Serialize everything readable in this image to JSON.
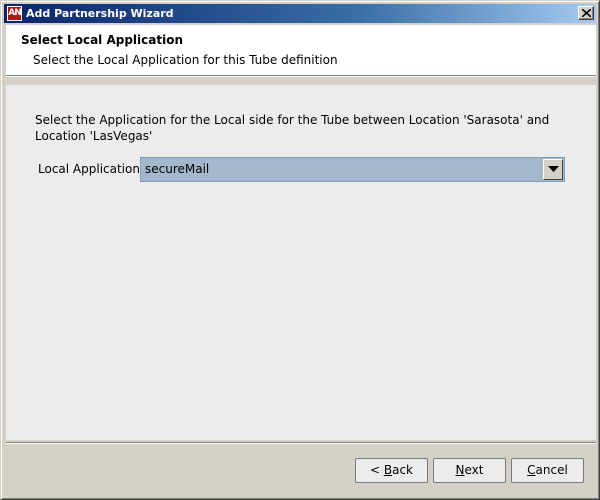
{
  "window": {
    "title": "Add Partnership Wizard",
    "app_icon_glyph": "AN",
    "accent_color": "#0a246a",
    "close_icon": "close-icon"
  },
  "header": {
    "title": "Select Local Application",
    "subtitle": "Select the Local Application for this Tube definition"
  },
  "main": {
    "instruction": "Select the Application for the Local side for the Tube between Location 'Sarasota' and Location 'LasVegas'",
    "local_application": {
      "label": "Local Application",
      "value": "secureMail",
      "arrow_icon": "chevron-down-icon"
    }
  },
  "buttons": {
    "back": {
      "prefix": "< ",
      "mnemonic": "B",
      "rest": "ack"
    },
    "next": {
      "prefix": "",
      "mnemonic": "N",
      "rest": "ext"
    },
    "cancel": {
      "prefix": "",
      "mnemonic": "C",
      "rest": "ancel"
    }
  }
}
